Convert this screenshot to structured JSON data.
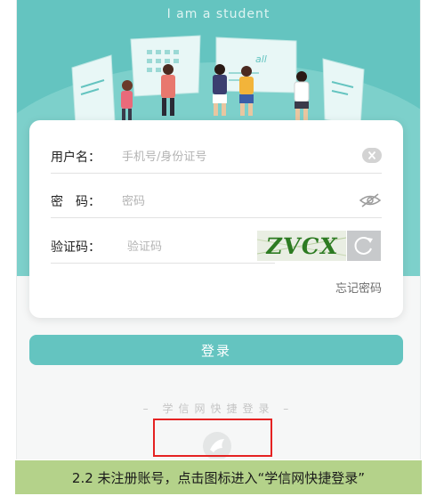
{
  "header": {
    "tagline": "I am a student"
  },
  "illustration": {
    "board_label": "all"
  },
  "form": {
    "username": {
      "label": "用户名：",
      "placeholder": "手机号/身份证号",
      "value": ""
    },
    "password": {
      "label": "密　码：",
      "placeholder": "密码",
      "value": ""
    },
    "captcha": {
      "label": "验证码：",
      "placeholder": "验证码",
      "value": "",
      "image_text": "ZVCX"
    },
    "forgot_password": "忘记密码",
    "submit_label": "登录"
  },
  "quick_login": {
    "divider_text": "– 学信网快捷登录 –",
    "icon": "chsi-quick-login-icon"
  },
  "caption": "2.2 未注册账号，点击图标进入“学信网快捷登录”",
  "colors": {
    "accent": "#64c4c0",
    "highlight": "#e52222",
    "caption_bg": "#b4d28a"
  }
}
